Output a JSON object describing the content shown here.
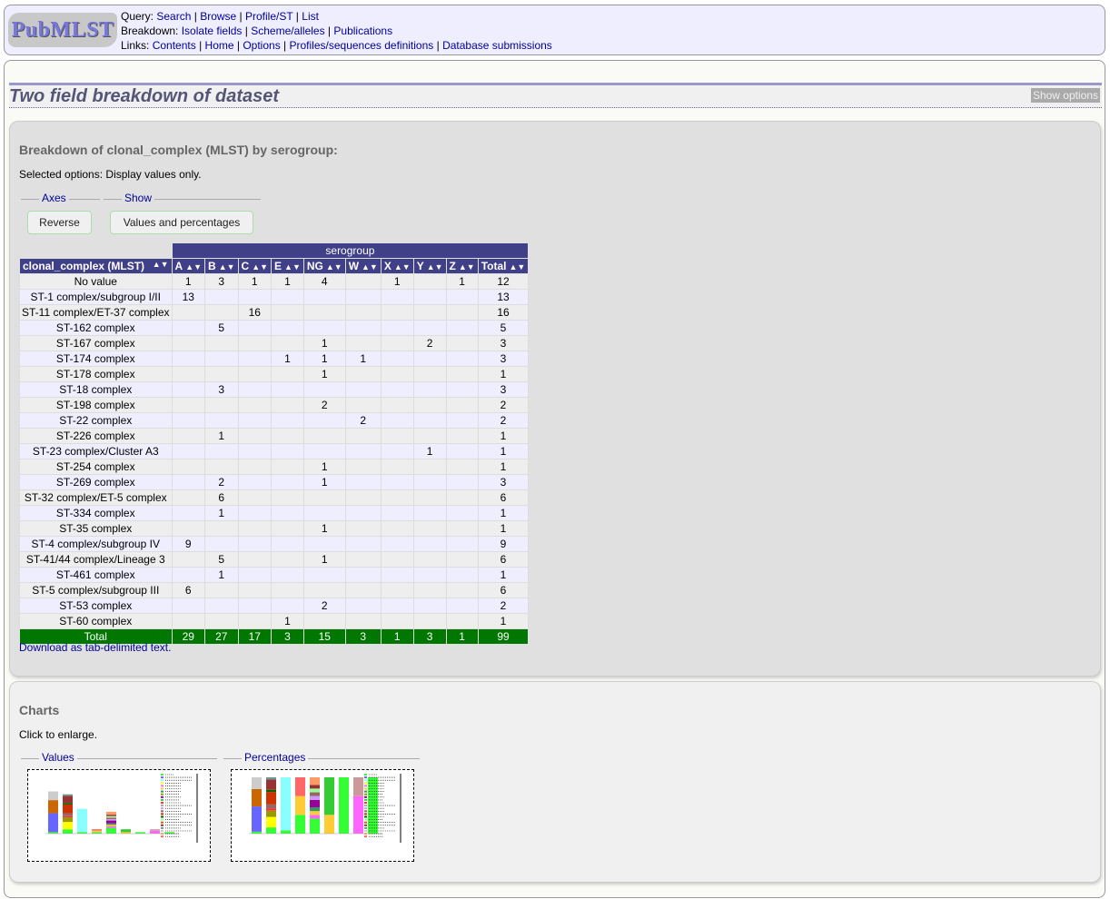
{
  "header": {
    "logo": "PubMLST",
    "query_label": "Query:",
    "query_links": [
      "Search",
      "Browse",
      "Profile/ST",
      "List"
    ],
    "breakdown_label": "Breakdown:",
    "breakdown_links": [
      "Isolate fields",
      "Scheme/alleles",
      "Publications"
    ],
    "links_label": "Links:",
    "links": [
      "Contents",
      "Home",
      "Options",
      "Profiles/sequences definitions",
      "Database submissions"
    ]
  },
  "page": {
    "title": "Two field breakdown of dataset",
    "show_options": "Show options"
  },
  "breakdown": {
    "heading": "Breakdown of clonal_complex (MLST) by serogroup:",
    "selected_options": "Selected options: Display values only.",
    "axes_legend": "Axes",
    "reverse_button": "Reverse",
    "show_legend": "Show",
    "show_button": "Values and percentages",
    "group_header": "serogroup",
    "row_field": "clonal_complex (MLST)",
    "columns": [
      "A",
      "B",
      "C",
      "E",
      "NG",
      "W",
      "X",
      "Y",
      "Z",
      "Total"
    ],
    "rows": [
      {
        "label": "No value",
        "values": [
          "1",
          "3",
          "1",
          "1",
          "4",
          "",
          "1",
          "",
          "1",
          "12"
        ]
      },
      {
        "label": "ST-1 complex/subgroup I/II",
        "values": [
          "13",
          "",
          "",
          "",
          "",
          "",
          "",
          "",
          "",
          "13"
        ]
      },
      {
        "label": "ST-11 complex/ET-37 complex",
        "values": [
          "",
          "",
          "16",
          "",
          "",
          "",
          "",
          "",
          "",
          "16"
        ]
      },
      {
        "label": "ST-162 complex",
        "values": [
          "",
          "5",
          "",
          "",
          "",
          "",
          "",
          "",
          "",
          "5"
        ]
      },
      {
        "label": "ST-167 complex",
        "values": [
          "",
          "",
          "",
          "",
          "1",
          "",
          "",
          "2",
          "",
          "3"
        ]
      },
      {
        "label": "ST-174 complex",
        "values": [
          "",
          "",
          "",
          "1",
          "1",
          "1",
          "",
          "",
          "",
          "3"
        ]
      },
      {
        "label": "ST-178 complex",
        "values": [
          "",
          "",
          "",
          "",
          "1",
          "",
          "",
          "",
          "",
          "1"
        ]
      },
      {
        "label": "ST-18 complex",
        "values": [
          "",
          "3",
          "",
          "",
          "",
          "",
          "",
          "",
          "",
          "3"
        ]
      },
      {
        "label": "ST-198 complex",
        "values": [
          "",
          "",
          "",
          "",
          "2",
          "",
          "",
          "",
          "",
          "2"
        ]
      },
      {
        "label": "ST-22 complex",
        "values": [
          "",
          "",
          "",
          "",
          "",
          "2",
          "",
          "",
          "",
          "2"
        ]
      },
      {
        "label": "ST-226 complex",
        "values": [
          "",
          "1",
          "",
          "",
          "",
          "",
          "",
          "",
          "",
          "1"
        ]
      },
      {
        "label": "ST-23 complex/Cluster A3",
        "values": [
          "",
          "",
          "",
          "",
          "",
          "",
          "",
          "1",
          "",
          "1"
        ]
      },
      {
        "label": "ST-254 complex",
        "values": [
          "",
          "",
          "",
          "",
          "1",
          "",
          "",
          "",
          "",
          "1"
        ]
      },
      {
        "label": "ST-269 complex",
        "values": [
          "",
          "2",
          "",
          "",
          "1",
          "",
          "",
          "",
          "",
          "3"
        ]
      },
      {
        "label": "ST-32 complex/ET-5 complex",
        "values": [
          "",
          "6",
          "",
          "",
          "",
          "",
          "",
          "",
          "",
          "6"
        ]
      },
      {
        "label": "ST-334 complex",
        "values": [
          "",
          "1",
          "",
          "",
          "",
          "",
          "",
          "",
          "",
          "1"
        ]
      },
      {
        "label": "ST-35 complex",
        "values": [
          "",
          "",
          "",
          "",
          "1",
          "",
          "",
          "",
          "",
          "1"
        ]
      },
      {
        "label": "ST-4 complex/subgroup IV",
        "values": [
          "9",
          "",
          "",
          "",
          "",
          "",
          "",
          "",
          "",
          "9"
        ]
      },
      {
        "label": "ST-41/44 complex/Lineage 3",
        "values": [
          "",
          "5",
          "",
          "",
          "1",
          "",
          "",
          "",
          "",
          "6"
        ]
      },
      {
        "label": "ST-461 complex",
        "values": [
          "",
          "1",
          "",
          "",
          "",
          "",
          "",
          "",
          "",
          "1"
        ]
      },
      {
        "label": "ST-5 complex/subgroup III",
        "values": [
          "6",
          "",
          "",
          "",
          "",
          "",
          "",
          "",
          "",
          "6"
        ]
      },
      {
        "label": "ST-53 complex",
        "values": [
          "",
          "",
          "",
          "",
          "2",
          "",
          "",
          "",
          "",
          "2"
        ]
      },
      {
        "label": "ST-60 complex",
        "values": [
          "",
          "",
          "",
          "1",
          "",
          "",
          "",
          "",
          "",
          "1"
        ]
      }
    ],
    "total": {
      "label": "Total",
      "values": [
        "29",
        "27",
        "17",
        "3",
        "15",
        "3",
        "1",
        "3",
        "1",
        "99"
      ]
    },
    "download": "Download as tab-delimited text."
  },
  "charts": {
    "heading": "Charts",
    "note": "Click to enlarge.",
    "values_legend": "Values",
    "percentages_legend": "Percentages"
  },
  "colors": {
    "table_header": "#404088",
    "total_row": "#007700",
    "link": "#000099",
    "series": [
      "#33ff33",
      "#6666ff",
      "#88ffff",
      "#ffff00",
      "#ff66ff",
      "#ffcc33",
      "#339966",
      "#999900",
      "#990099",
      "#33cc33",
      "#ff3333",
      "#cc9999",
      "#cc99ff",
      "#996666",
      "#cc3300",
      "#006600",
      "#99ff99",
      "#cc6600",
      "#993333",
      "#669999",
      "#cccccc",
      "#ff9966",
      "#ff6666"
    ]
  }
}
